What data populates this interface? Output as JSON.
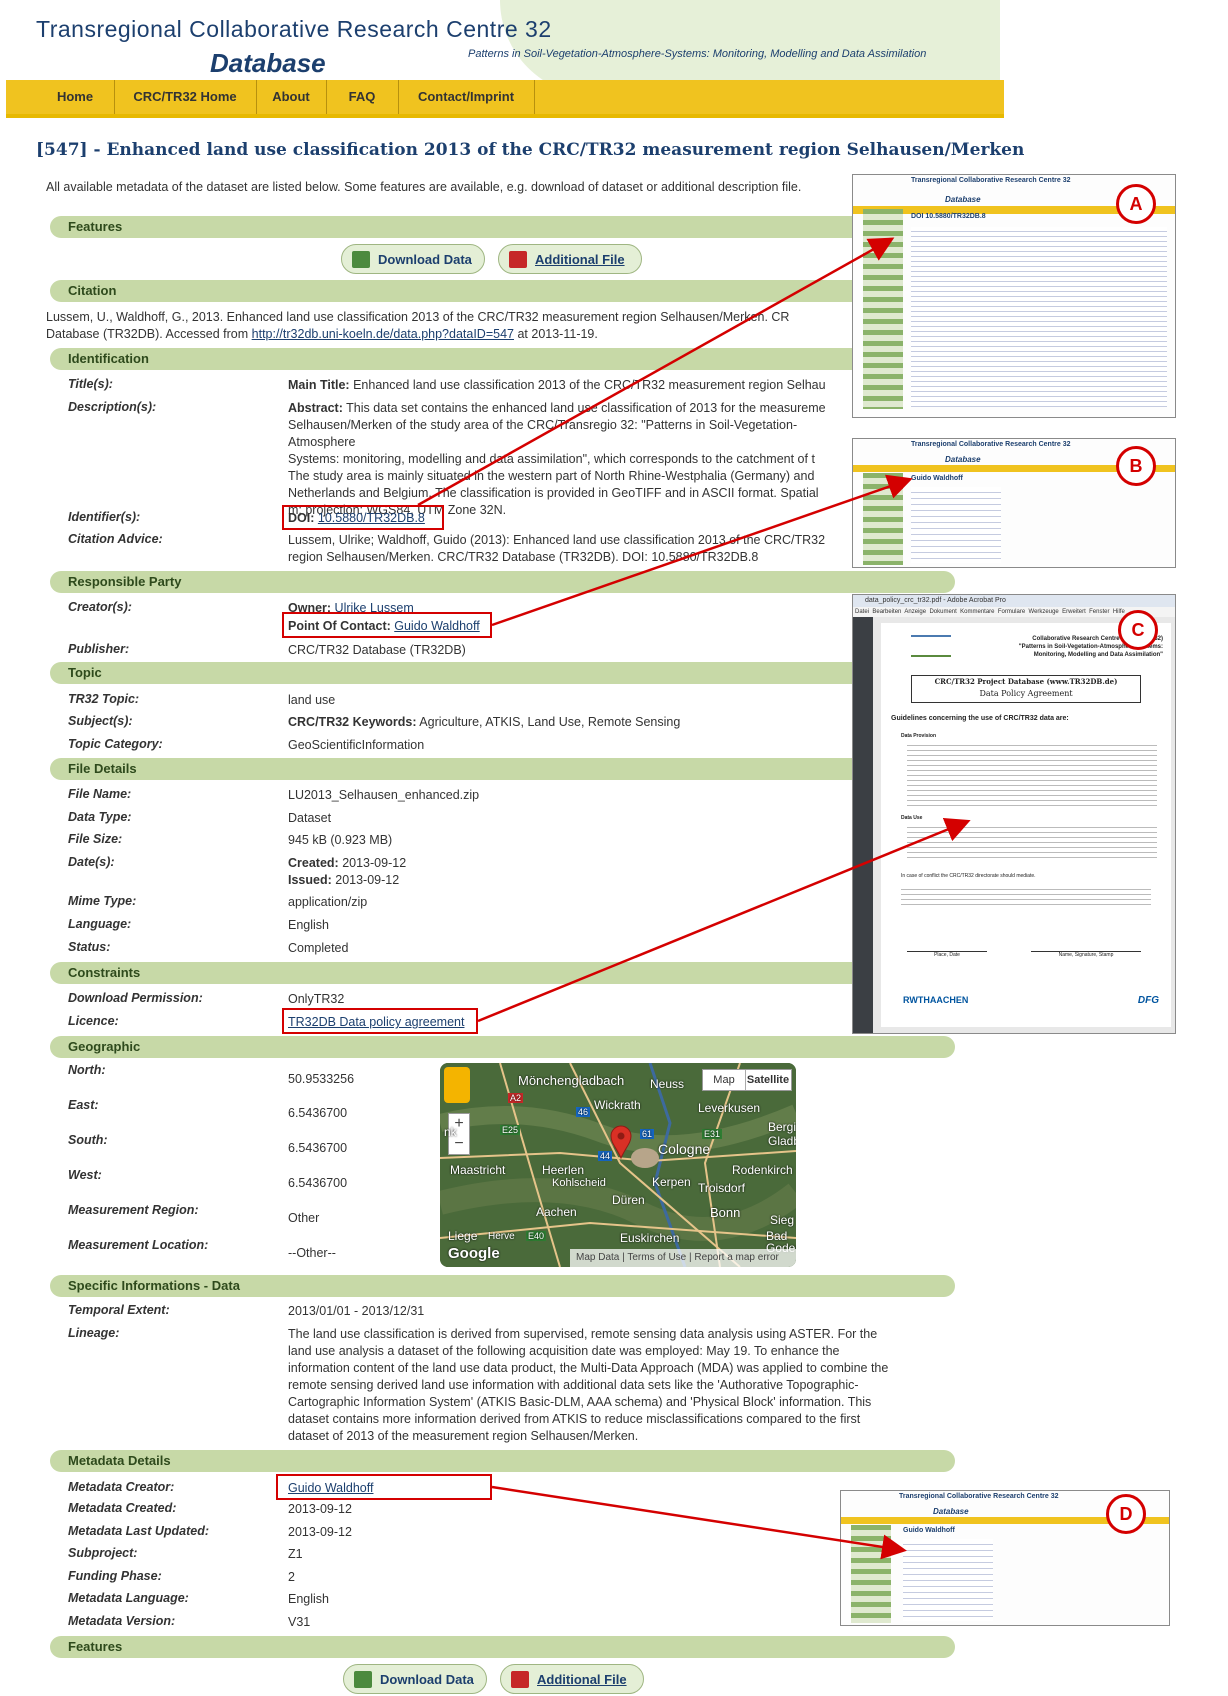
{
  "header": {
    "title_line": "Transregional Collaborative Research Centre 32",
    "db_title": "Database",
    "subtitle": "Patterns in Soil-Vegetation-Atmosphere-Systems: Monitoring, Modelling and Data Assimilation"
  },
  "nav": [
    "Home",
    "CRC/TR32 Home",
    "About",
    "FAQ",
    "Contact/Imprint"
  ],
  "page_title": "[547] - Enhanced land use classification 2013 of the CRC/TR32 measurement region Selhausen/Merken",
  "intro": "All available metadata of the dataset are listed below. Some features are available, e.g. download of dataset or additional description file.",
  "features": {
    "title": "Features",
    "download": "Download Data",
    "additional": "Additional File"
  },
  "citation": {
    "title": "Citation",
    "text1": "Lussem, U., Waldhoff, G., 2013. Enhanced land use classification 2013 of the CRC/TR32 measurement region Selhausen/Merken. CR",
    "text2a": "Database (TR32DB). Accessed from ",
    "url": "http://tr32db.uni-koeln.de/data.php?dataID=547",
    "text2b": " at 2013-11-19."
  },
  "identification": {
    "title": "Identification",
    "title_label": "Title(s):",
    "title_prefix": "Main Title:",
    "title_value": "Enhanced land use classification 2013 of the CRC/TR32 measurement region Selhau",
    "desc_label": "Description(s):",
    "desc_prefix": "Abstract:",
    "desc_lines": [
      "This data set contains the enhanced land use classification of 2013 for the measureme",
      "Selhausen/Merken of the study area of the CRC/Transregio 32: \"Patterns in Soil-Vegetation-Atmosphere",
      "Systems: monitoring, modelling and data assimilation\", which corresponds to the catchment of t",
      "The study area is mainly situated in the western part of North Rhine-Westphalia (Germany) and",
      "Netherlands and Belgium. The classification is provided in GeoTIFF and in ASCII format. Spatial",
      "m; projection: WGS84, UTM Zone 32N."
    ],
    "identifier_label": "Identifier(s):",
    "doi_prefix": "DOI:",
    "doi": "10.5880/TR32DB.8",
    "cit_label": "Citation Advice:",
    "cit_lines": [
      "Lussem, Ulrike; Waldhoff, Guido (2013): Enhanced land use classification 2013 of the CRC/TR32",
      "region Selhausen/Merken. CRC/TR32 Database (TR32DB). DOI: 10.5880/TR32DB.8"
    ]
  },
  "responsible": {
    "title": "Responsible Party",
    "creator_label": "Creator(s):",
    "owner_prefix": "Owner:",
    "owner": "Ulrike Lussem",
    "poc_prefix": "Point Of Contact:",
    "poc": "Guido Waldhoff",
    "publisher_label": "Publisher:",
    "publisher": "CRC/TR32 Database (TR32DB)"
  },
  "topic": {
    "title": "Topic",
    "tr32_label": "TR32 Topic:",
    "tr32": "land use",
    "subject_label": "Subject(s):",
    "subject_prefix": "CRC/TR32 Keywords:",
    "subject": "Agriculture, ATKIS, Land Use, Remote Sensing",
    "cat_label": "Topic Category:",
    "cat": "GeoScientificInformation"
  },
  "file": {
    "title": "File Details",
    "name_label": "File Name:",
    "name": "LU2013_Selhausen_enhanced.zip",
    "type_label": "Data Type:",
    "type": "Dataset",
    "size_label": "File Size:",
    "size": "945 kB (0.923 MB)",
    "dates_label": "Date(s):",
    "created_prefix": "Created:",
    "created": "2013-09-12",
    "issued_prefix": "Issued:",
    "issued": "2013-09-12",
    "mime_label": "Mime Type:",
    "mime": "application/zip",
    "lang_label": "Language:",
    "lang": "English",
    "status_label": "Status:",
    "status": "Completed"
  },
  "constraints": {
    "title": "Constraints",
    "perm_label": "Download Permission:",
    "perm": "OnlyTR32",
    "licence_label": "Licence:",
    "licence": "TR32DB Data policy agreement"
  },
  "geographic": {
    "title": "Geographic",
    "north_label": "North:",
    "north": "50.9533256",
    "east_label": "East:",
    "east": "6.5436700",
    "south_label": "South:",
    "south": "6.5436700",
    "west_label": "West:",
    "west": "6.5436700",
    "region_label": "Measurement Region:",
    "region": "Other",
    "location_label": "Measurement Location:",
    "location": "--Other--"
  },
  "map": {
    "map_btn": "Map",
    "sat_btn": "Satellite",
    "places": [
      "Mönchengladbach",
      "Neuss",
      "Wickrath",
      "Leverkusen",
      "Bergis",
      "Gladba",
      "Cologne",
      "Maastricht",
      "Heerlen",
      "Kohlscheid",
      "Kerpen",
      "Rodenkirch",
      "Troisdorf",
      "Düren",
      "Aachen",
      "Bonn",
      "Sieg",
      "Liege",
      "Herve",
      "Euskirchen",
      "Bad",
      "Godes",
      "nk"
    ],
    "roads": [
      "A2",
      "46",
      "E25",
      "61",
      "E31",
      "44",
      "E40"
    ],
    "footer": [
      "Map Data",
      "Terms of Use",
      "Report a map error"
    ],
    "google": "Google",
    "zoom_in": "+",
    "zoom_out": "−"
  },
  "specific": {
    "title": "Specific Informations - Data",
    "temporal_label": "Temporal Extent:",
    "temporal": "2013/01/01 - 2013/12/31",
    "lineage_label": "Lineage:",
    "lineage_lines": [
      "The land use classification is derived from supervised, remote sensing data analysis using ASTER. For the",
      "land use analysis a dataset of the following acquisition date was employed: May 19. To enhance the",
      "information content of the land use data product, the Multi-Data Approach (MDA) was applied to combine the",
      "remote sensing derived land use information with additional data sets like the 'Authorative Topographic-",
      "Cartographic Information System' (ATKIS Basic-DLM, AAA schema) and 'Physical Block' information. This",
      "dataset contains more information derived from ATKIS to reduce misclassifications compared to the first",
      "dataset of 2013 of the measurement region Selhausen/Merken."
    ]
  },
  "metadata": {
    "title": "Metadata Details",
    "creator_label": "Metadata Creator:",
    "creator": "Guido Waldhoff",
    "created_label": "Metadata Created:",
    "created": "2013-09-12",
    "updated_label": "Metadata Last Updated:",
    "updated": "2013-09-12",
    "subproject_label": "Subproject:",
    "subproject": "Z1",
    "phase_label": "Funding Phase:",
    "phase": "2",
    "lang_label": "Metadata Language:",
    "lang": "English",
    "version_label": "Metadata Version:",
    "version": "V31"
  },
  "features_bottom": {
    "title": "Features",
    "download": "Download Data",
    "additional": "Additional File"
  },
  "callouts": {
    "a": "A",
    "b": "B",
    "c": "C",
    "d": "D",
    "mini_title": "Transregional Collaborative Research Centre 32",
    "mini_db": "Database",
    "a_doi": "DOI 10.5880/TR32DB.8",
    "b_name": "Guido Waldhoff",
    "d_name": "Guido Waldhoff",
    "c_window": "data_policy_crc_tr32.pdf - Adobe Acrobat Pro",
    "c_menu": [
      "Datei",
      "Bearbeiten",
      "Anzeige",
      "Dokument",
      "Kommentare",
      "Formulare",
      "Werkzeuge",
      "Erweitert",
      "Fenster",
      "Hilfe"
    ],
    "c_org1": "Collaborative Research Centre 32 (CRC/TR32)",
    "c_org2": "\"Patterns in Soil-Vegetation-Atmosphere Systems:",
    "c_org3": "Monitoring, Modelling and Data Assimilation\"",
    "c_box1": "CRC/TR32 Project Database (www.TR32DB.de)",
    "c_box2": "Data Policy Agreement",
    "c_guidelines": "Guidelines concerning the use of CRC/TR32 data are:",
    "c_provision": "Data Provision",
    "c_use": "Data Use",
    "c_conflict": "In case of conflict the CRC/TR32 directorate should mediate.",
    "c_place": "Place, Date",
    "c_sign": "Name, Signature, Stamp",
    "c_rwth": "RWTHAACHEN",
    "c_dfg": "DFG"
  },
  "colors": {
    "navy": "#1c3f6e",
    "nav_yellow": "#f0c31f",
    "section_green": "#c7d9a7",
    "callout_red": "#d40000"
  }
}
